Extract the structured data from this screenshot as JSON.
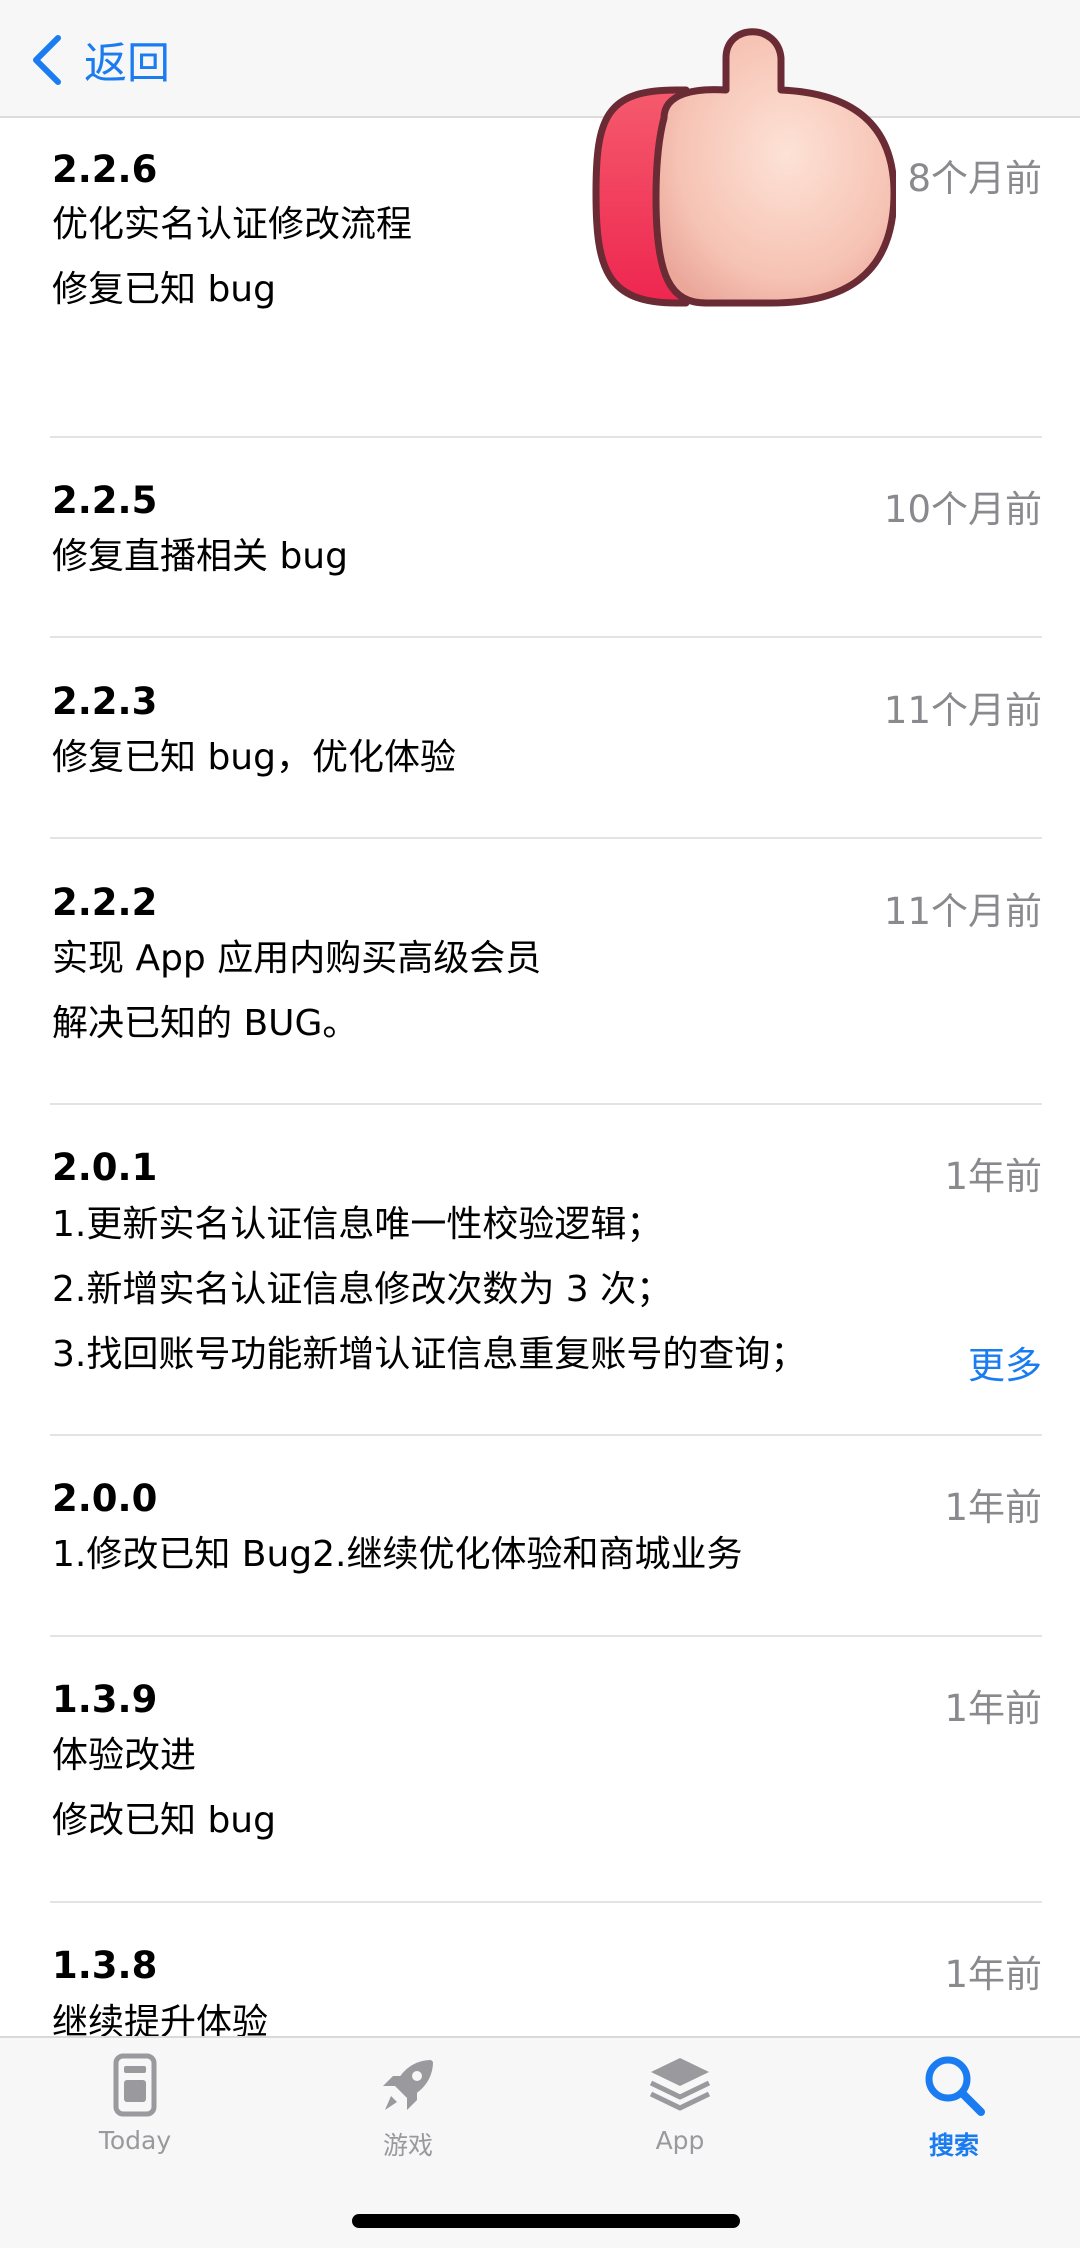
{
  "nav": {
    "back_label": "返回",
    "back_icon": "chevron-left-icon"
  },
  "versions": [
    {
      "version": "2.2.6",
      "date": "8个月前",
      "notes": [
        "优化实名认证修改流程",
        "修复已知 bug"
      ]
    },
    {
      "version": "2.2.5",
      "date": "10个月前",
      "notes": [
        "修复直播相关 bug"
      ]
    },
    {
      "version": "2.2.3",
      "date": "11个月前",
      "notes": [
        "修复已知 bug，优化体验"
      ]
    },
    {
      "version": "2.2.2",
      "date": "11个月前",
      "notes": [
        "实现 App 应用内购买高级会员",
        "解决已知的 BUG。"
      ]
    },
    {
      "version": "2.0.1",
      "date": "1年前",
      "notes": [
        "1.更新实名认证信息唯一性校验逻辑；",
        "2.新增实名认证信息修改次数为 3 次；",
        "3.找回账号功能新增认证信息重复账号的查询；"
      ],
      "more_label": "更多"
    },
    {
      "version": "2.0.0",
      "date": "1年前",
      "notes": [
        "1.修改已知 Bug2.继续优化体验和商城业务"
      ]
    },
    {
      "version": "1.3.9",
      "date": "1年前",
      "notes": [
        "体验改进",
        "修改已知 bug"
      ]
    },
    {
      "version": "1.3.8",
      "date": "1年前",
      "notes": [
        "继续提升体验"
      ]
    }
  ],
  "tabbar": {
    "tabs": [
      {
        "label": "Today",
        "icon": "today-icon",
        "active": false
      },
      {
        "label": "游戏",
        "icon": "rocket-icon",
        "active": false
      },
      {
        "label": "App",
        "icon": "app-stack-icon",
        "active": false
      },
      {
        "label": "搜索",
        "icon": "search-icon",
        "active": true
      }
    ]
  },
  "overlay": {
    "icon": "thumbs-up-sticker-icon"
  },
  "colors": {
    "accent": "#1a7cf0",
    "secondary_text": "#8a8a8e",
    "divider": "#e3e3e5"
  }
}
